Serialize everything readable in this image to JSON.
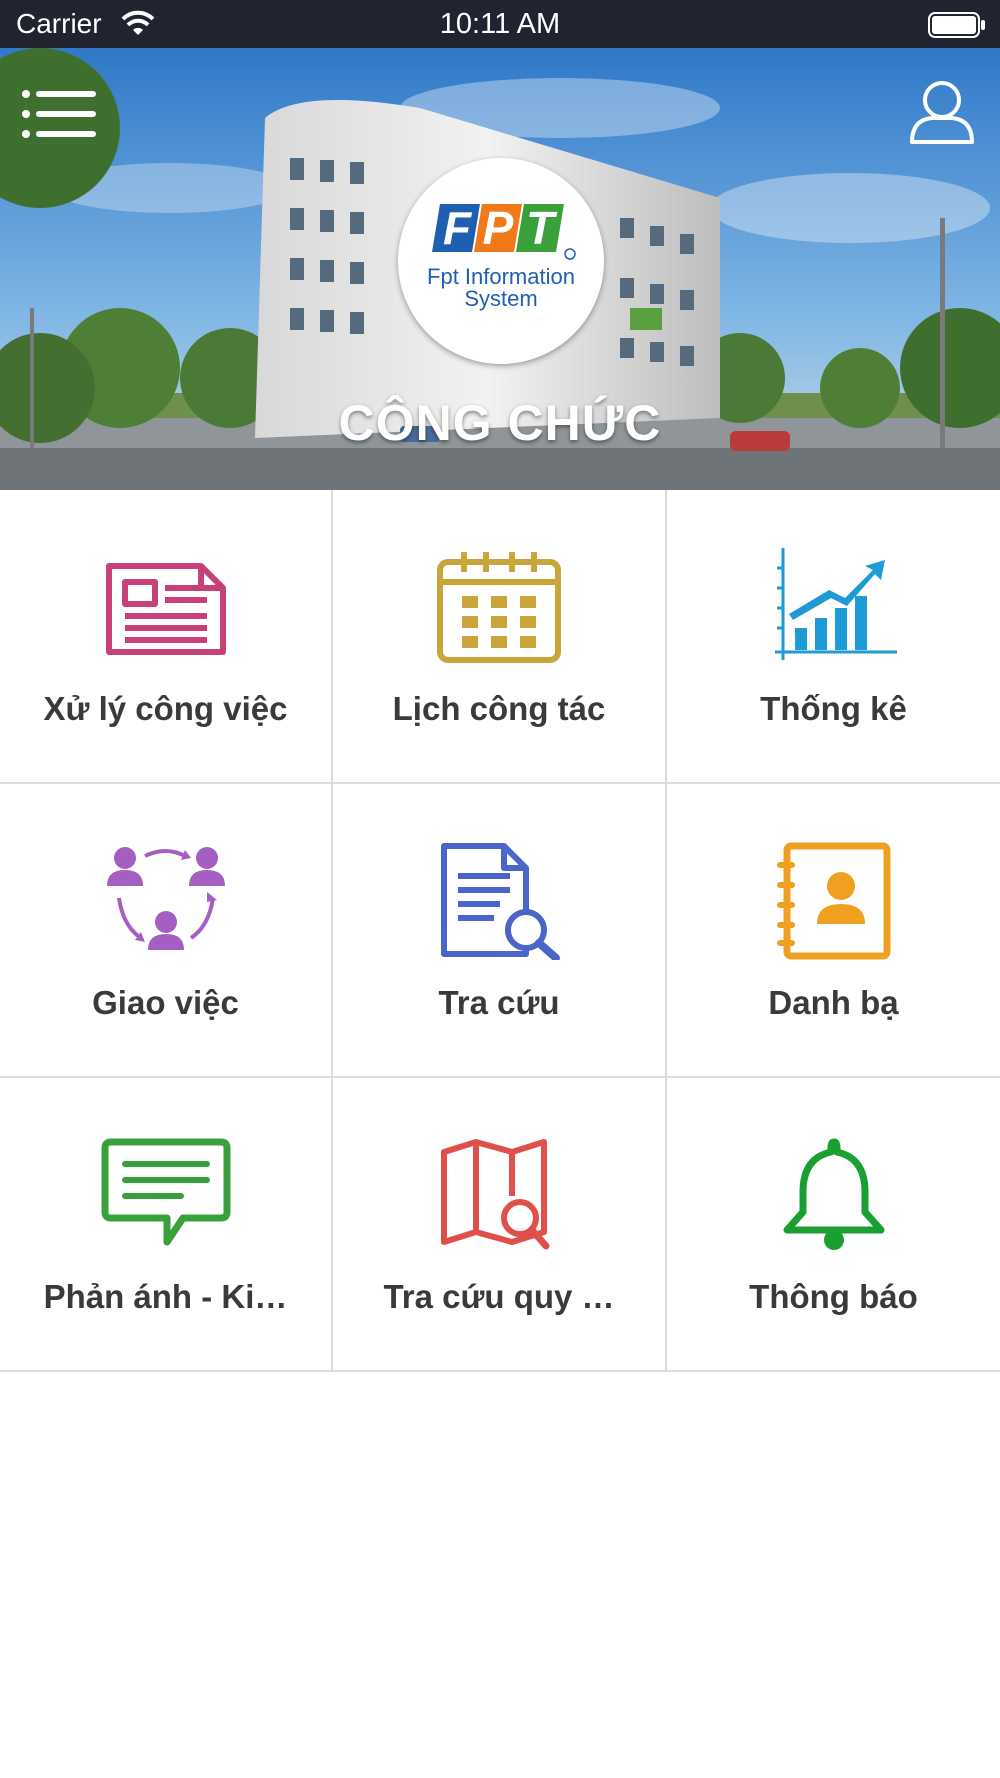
{
  "status_bar": {
    "carrier": "Carrier",
    "time": "10:11 AM"
  },
  "header": {
    "logo_brand": "FPT",
    "logo_line1": "Fpt Information",
    "logo_line2": "System",
    "title": "CÔNG CHỨC"
  },
  "menu": {
    "items": [
      {
        "label": "Xử lý công việc",
        "icon": "document-icon",
        "color": "#c8407a"
      },
      {
        "label": "Lịch công tác",
        "icon": "calendar-icon",
        "color": "#c9a53a"
      },
      {
        "label": "Thống kê",
        "icon": "statistics-chart-icon",
        "color": "#1e9ad6"
      },
      {
        "label": "Giao việc",
        "icon": "assign-people-icon",
        "color": "#a55fc2"
      },
      {
        "label": "Tra cứu",
        "icon": "document-search-icon",
        "color": "#4a66c9"
      },
      {
        "label": "Danh bạ",
        "icon": "contacts-book-icon",
        "color": "#f0a020"
      },
      {
        "label": "Phản ánh - Ki…",
        "icon": "chat-feedback-icon",
        "color": "#3aa03a"
      },
      {
        "label": "Tra cứu quy …",
        "icon": "map-search-icon",
        "color": "#e0504a"
      },
      {
        "label": "Thông báo",
        "icon": "bell-icon",
        "color": "#1aa030"
      }
    ]
  }
}
